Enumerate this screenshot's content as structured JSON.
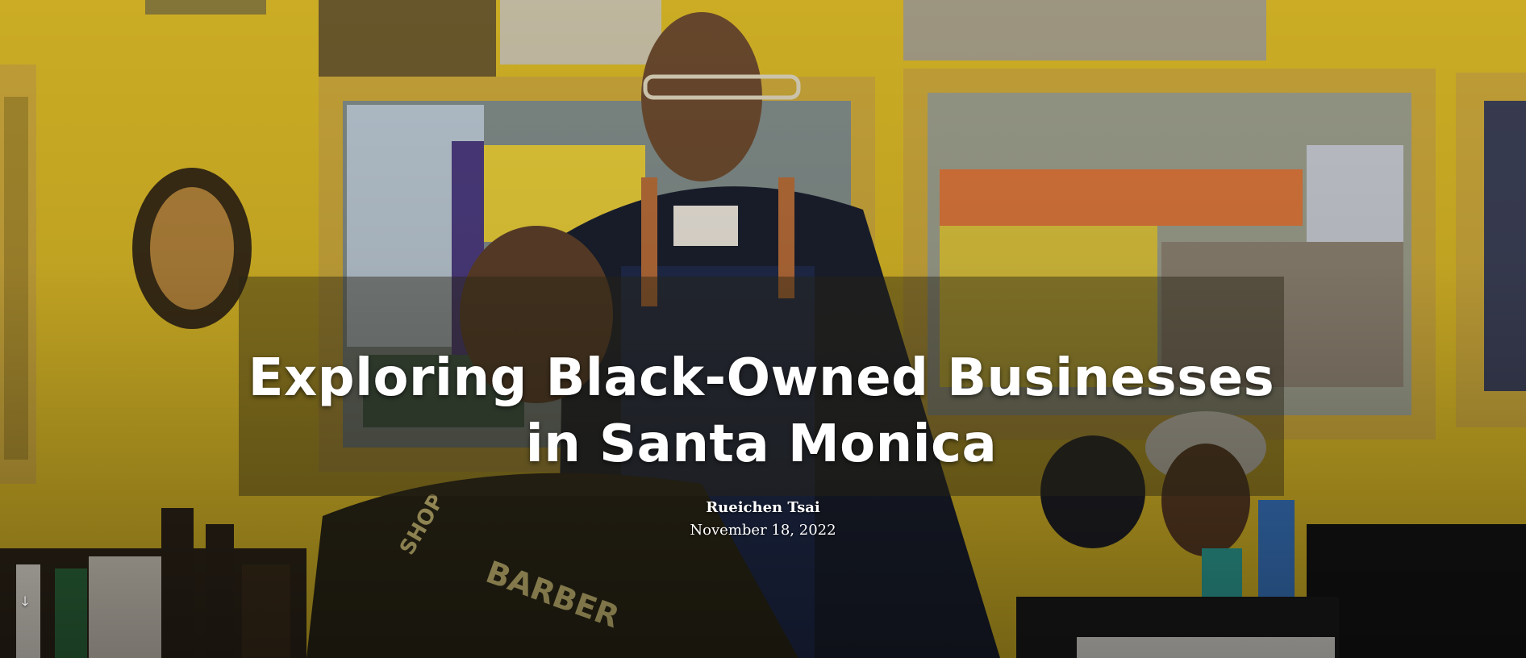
{
  "story": {
    "title": "Exploring Black-Owned Businesses in Santa Monica",
    "author": "Rueichen Tsai",
    "date": "November 18, 2022"
  },
  "controls": {
    "scroll_icon": "arrow-down-icon",
    "scroll_glyph": "🡓"
  },
  "colors": {
    "wall": "#d8b724",
    "frame": "#c9a63a",
    "panel": "#28231a",
    "text": "#ffffff"
  }
}
